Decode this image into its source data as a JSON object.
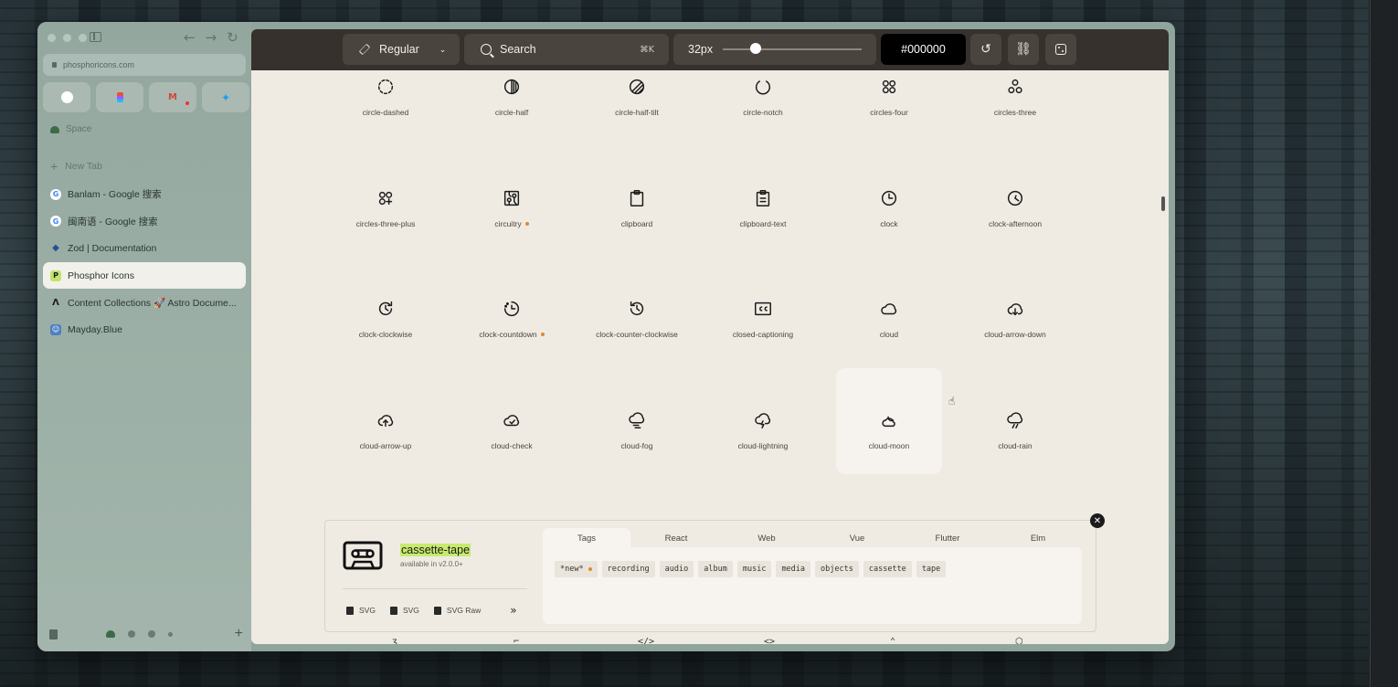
{
  "browser": {
    "url": "phosphoricons.com",
    "space_name": "Space",
    "new_tab_label": "New Tab",
    "tabs": [
      {
        "title": "Banlam - Google 搜索",
        "favicon": "google-icon",
        "active": false
      },
      {
        "title": "闽南语 - Google 搜索",
        "favicon": "google-icon",
        "active": false
      },
      {
        "title": "Zod | Documentation",
        "favicon": "zod-icon",
        "active": false
      },
      {
        "title": "Phosphor Icons",
        "favicon": "phosphor-icon",
        "active": true
      },
      {
        "title": "Content Collections 🚀 Astro Docume...",
        "favicon": "astro-icon",
        "active": false
      },
      {
        "title": "Mayday.Blue",
        "favicon": "mayday-icon",
        "active": false
      }
    ],
    "pinned": [
      "github-icon",
      "figma-icon",
      "gmail-icon",
      "twitter-icon"
    ]
  },
  "toolbar": {
    "weight": "Regular",
    "search_placeholder": "Search",
    "search_shortcut": "⌘K",
    "size": "32px",
    "size_level": 0.2,
    "color": "#000000"
  },
  "icons": [
    {
      "name": "circle-dashed",
      "new": false
    },
    {
      "name": "circle-half",
      "new": false
    },
    {
      "name": "circle-half-tilt",
      "new": false
    },
    {
      "name": "circle-notch",
      "new": false
    },
    {
      "name": "circles-four",
      "new": false
    },
    {
      "name": "circles-three",
      "new": false
    },
    {
      "name": "circles-three-plus",
      "new": false
    },
    {
      "name": "circuitry",
      "new": true
    },
    {
      "name": "clipboard",
      "new": false
    },
    {
      "name": "clipboard-text",
      "new": false
    },
    {
      "name": "clock",
      "new": false
    },
    {
      "name": "clock-afternoon",
      "new": false
    },
    {
      "name": "clock-clockwise",
      "new": false
    },
    {
      "name": "clock-countdown",
      "new": true
    },
    {
      "name": "clock-counter-clockwise",
      "new": false
    },
    {
      "name": "closed-captioning",
      "new": false
    },
    {
      "name": "cloud",
      "new": false
    },
    {
      "name": "cloud-arrow-down",
      "new": false
    },
    {
      "name": "cloud-arrow-up",
      "new": false
    },
    {
      "name": "cloud-check",
      "new": false
    },
    {
      "name": "cloud-fog",
      "new": false
    },
    {
      "name": "cloud-lightning",
      "new": false
    },
    {
      "name": "cloud-moon",
      "new": false
    },
    {
      "name": "cloud-rain",
      "new": false
    }
  ],
  "detail": {
    "name": "cassette-tape",
    "available": "available in v2.0.0+",
    "actions": [
      "SVG",
      "SVG",
      "SVG Raw"
    ],
    "tabs": [
      "Tags",
      "React",
      "Web",
      "Vue",
      "Flutter",
      "Elm"
    ],
    "active_tab": "Tags",
    "tags": [
      "*new*",
      "recording",
      "audio",
      "album",
      "music",
      "media",
      "objects",
      "cassette",
      "tape"
    ]
  },
  "colors": {
    "accent_highlight": "#c8ea6e",
    "new_dot": "#e08a2c",
    "toolbar_bg": "#36312c",
    "content_bg": "#efebe3"
  }
}
